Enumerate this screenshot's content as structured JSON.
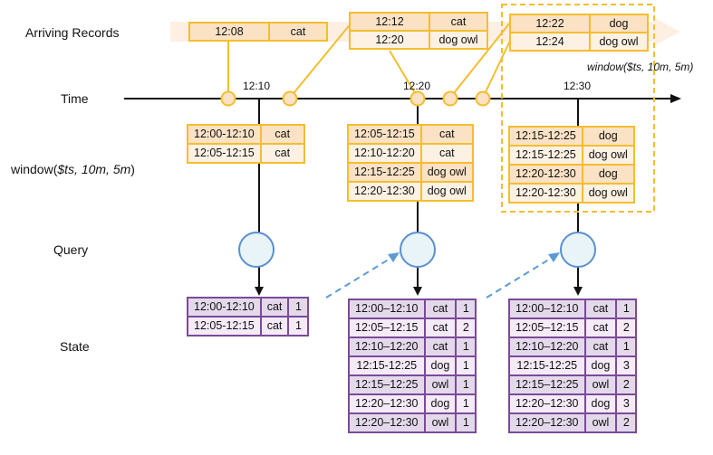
{
  "row_labels": {
    "arriving": "Arriving Records",
    "time": "Time",
    "window_prefix": "window(",
    "window_args": "$ts, 10m, 5m",
    "window_suffix": ")",
    "query": "Query",
    "state": "State"
  },
  "time_ticks": [
    "12:10",
    "12:20",
    "12:30"
  ],
  "window_annotation": "window($ts, 10m, 5m)",
  "arriving_records": [
    {
      "rows": [
        [
          "12:08",
          "cat"
        ]
      ]
    },
    {
      "rows": [
        [
          "12:12",
          "cat"
        ],
        [
          "12:20",
          "dog owl"
        ]
      ]
    },
    {
      "rows": [
        [
          "12:22",
          "dog"
        ],
        [
          "12:24",
          "dog owl"
        ]
      ]
    }
  ],
  "window_tables": [
    {
      "rows": [
        [
          "12:00-12:10",
          "cat"
        ],
        [
          "12:05-12:15",
          "cat"
        ]
      ]
    },
    {
      "rows": [
        [
          "12:05-12:15",
          "cat"
        ],
        [
          "12:10-12:20",
          "cat"
        ],
        [
          "12:15-12:25",
          "dog owl"
        ],
        [
          "12:20-12:30",
          "dog owl"
        ]
      ]
    },
    {
      "rows": [
        [
          "12:15-12:25",
          "dog"
        ],
        [
          "12:15-12:25",
          "dog owl"
        ],
        [
          "12:20-12:30",
          "dog"
        ],
        [
          "12:20-12:30",
          "dog owl"
        ]
      ]
    }
  ],
  "state_tables": [
    {
      "rows": [
        [
          "12:00-12:10",
          "cat",
          "1"
        ],
        [
          "12:05-12:15",
          "cat",
          "1"
        ]
      ]
    },
    {
      "rows": [
        [
          "12:00–12:10",
          "cat",
          "1"
        ],
        [
          "12:05–12:15",
          "cat",
          "2"
        ],
        [
          "12:10–12:20",
          "cat",
          "1"
        ],
        [
          "12:15-12:25",
          "dog",
          "1"
        ],
        [
          "12:15–12:25",
          "owl",
          "1"
        ],
        [
          "12:20–12:30",
          "dog",
          "1"
        ],
        [
          "12:20–12:30",
          "owl",
          "1"
        ]
      ]
    },
    {
      "rows": [
        [
          "12:00–12:10",
          "cat",
          "1"
        ],
        [
          "12:05–12:15",
          "cat",
          "2"
        ],
        [
          "12:10–12:20",
          "cat",
          "1"
        ],
        [
          "12:15-12:25",
          "dog",
          "3"
        ],
        [
          "12:15–12:25",
          "owl",
          "2"
        ],
        [
          "12:20–12:30",
          "dog",
          "3"
        ],
        [
          "12:20–12:30",
          "owl",
          "2"
        ]
      ]
    }
  ],
  "colors": {
    "record_border": "#f5bd2e",
    "record_fill": "#fbe2c5",
    "band": "#fdf0e2",
    "state_border": "#7a4b98",
    "query_node_fill": "#e8f4f8",
    "query_node_stroke": "#5b8fd0",
    "dashed_arrow": "#5b9bd5",
    "axis": "#111111"
  }
}
